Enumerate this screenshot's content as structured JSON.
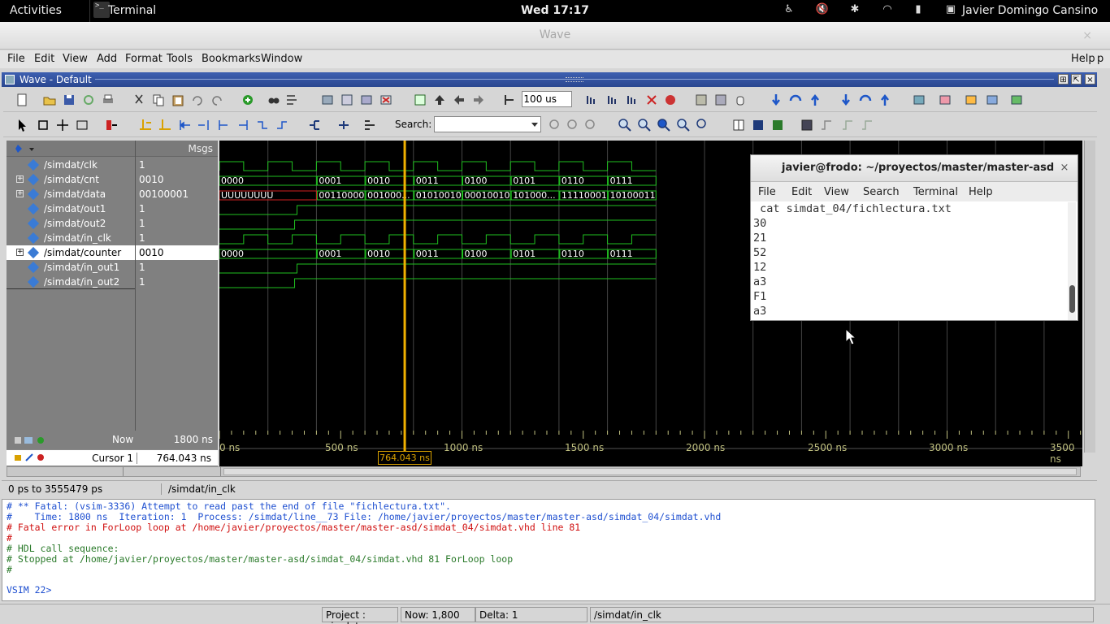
{
  "topbar": {
    "activities": "Activities",
    "app": "Terminal",
    "app_icon_text": ">_",
    "clock": "Wed 17:17",
    "user": "Javier Domingo Cansino",
    "tray_icons": [
      "accessibility-icon",
      "volume-muted-icon",
      "bluetooth-icon",
      "wifi-icon",
      "battery-icon"
    ]
  },
  "window": {
    "title": "Wave",
    "close": "×"
  },
  "menu": [
    "File",
    "Edit",
    "View",
    "Add",
    "Format",
    "Tools",
    "Bookmarks",
    "Window"
  ],
  "help": "Help",
  "help_overflow": "p",
  "inner_title": "Wave - Default",
  "toolbar": {
    "zoom_value": "100 us",
    "search_label": "Search:"
  },
  "wave": {
    "msgs_header": "Msgs",
    "signals": [
      {
        "name": "/simdat/clk",
        "value": "1",
        "expandable": false
      },
      {
        "name": "/simdat/cnt",
        "value": "0010",
        "expandable": true
      },
      {
        "name": "/simdat/data",
        "value": "00100001",
        "expandable": true
      },
      {
        "name": "/simdat/out1",
        "value": "1",
        "expandable": false
      },
      {
        "name": "/simdat/out2",
        "value": "1",
        "expandable": false
      },
      {
        "name": "/simdat/in_clk",
        "value": "1",
        "expandable": false
      },
      {
        "name": "/simdat/counter",
        "value": "0010",
        "expandable": true,
        "selected": true
      },
      {
        "name": "/simdat/in_out1",
        "value": "1",
        "expandable": false
      },
      {
        "name": "/simdat/in_out2",
        "value": "1",
        "expandable": false
      }
    ],
    "bus_labels": {
      "cnt": [
        "0000",
        "0001",
        "0010",
        "0011",
        "0100",
        "0101",
        "0110",
        "0111"
      ],
      "data": [
        "UUUUUUUU",
        "00110000",
        "001000...",
        "01010010",
        "00010010",
        "101000...",
        "11110001",
        "10100011"
      ],
      "counter": [
        "0000",
        "0001",
        "0010",
        "0011",
        "0100",
        "0101",
        "0110",
        "0111"
      ]
    },
    "now_label": "Now",
    "now_value": "1800 ns",
    "cursor_label": "Cursor 1",
    "cursor_value": "764.043 ns",
    "cursor_flag": "764.043 ns",
    "ruler": [
      "0 ns",
      "500 ns",
      "1000 ns",
      "1500 ns",
      "2000 ns",
      "2500 ns",
      "3000 ns",
      "3500 ns"
    ],
    "range": "0 ps to 3555479 ps",
    "selected_path": "/simdat/in_clk"
  },
  "transcript": [
    {
      "cls": "",
      "text": "# ** Fatal: (vsim-3336) Attempt to read past the end of file \"fichlectura.txt\"."
    },
    {
      "cls": "",
      "text": "#    Time: 1800 ns  Iteration: 1  Process: /simdat/line__73 File: /home/javier/proyectos/master/master-asd/simdat_04/simdat.vhd"
    },
    {
      "cls": "red",
      "text": "# Fatal error in ForLoop loop at /home/javier/proyectos/master/master-asd/simdat_04/simdat.vhd line 81"
    },
    {
      "cls": "red",
      "text": "#"
    },
    {
      "cls": "green",
      "text": "# HDL call sequence:"
    },
    {
      "cls": "green",
      "text": "# Stopped at /home/javier/proyectos/master/master-asd/simdat_04/simdat.vhd 81 ForLoop loop"
    },
    {
      "cls": "green",
      "text": "#"
    }
  ],
  "prompt": "VSIM 22>",
  "status": {
    "project": "Project : simdat",
    "now": "Now: 1,800 ns",
    "delta": "Delta: 1",
    "path": "/simdat/in_clk"
  },
  "terminal": {
    "title": "javier@frodo: ~/proyectos/master/master-asd",
    "close": "×",
    "menu": [
      "File",
      "Edit",
      "View",
      "Search",
      "Terminal",
      "Help"
    ],
    "lines": [
      " cat simdat_04/fichlectura.txt",
      "30",
      "21",
      "52",
      "12",
      "a3",
      "F1",
      "a3"
    ]
  }
}
